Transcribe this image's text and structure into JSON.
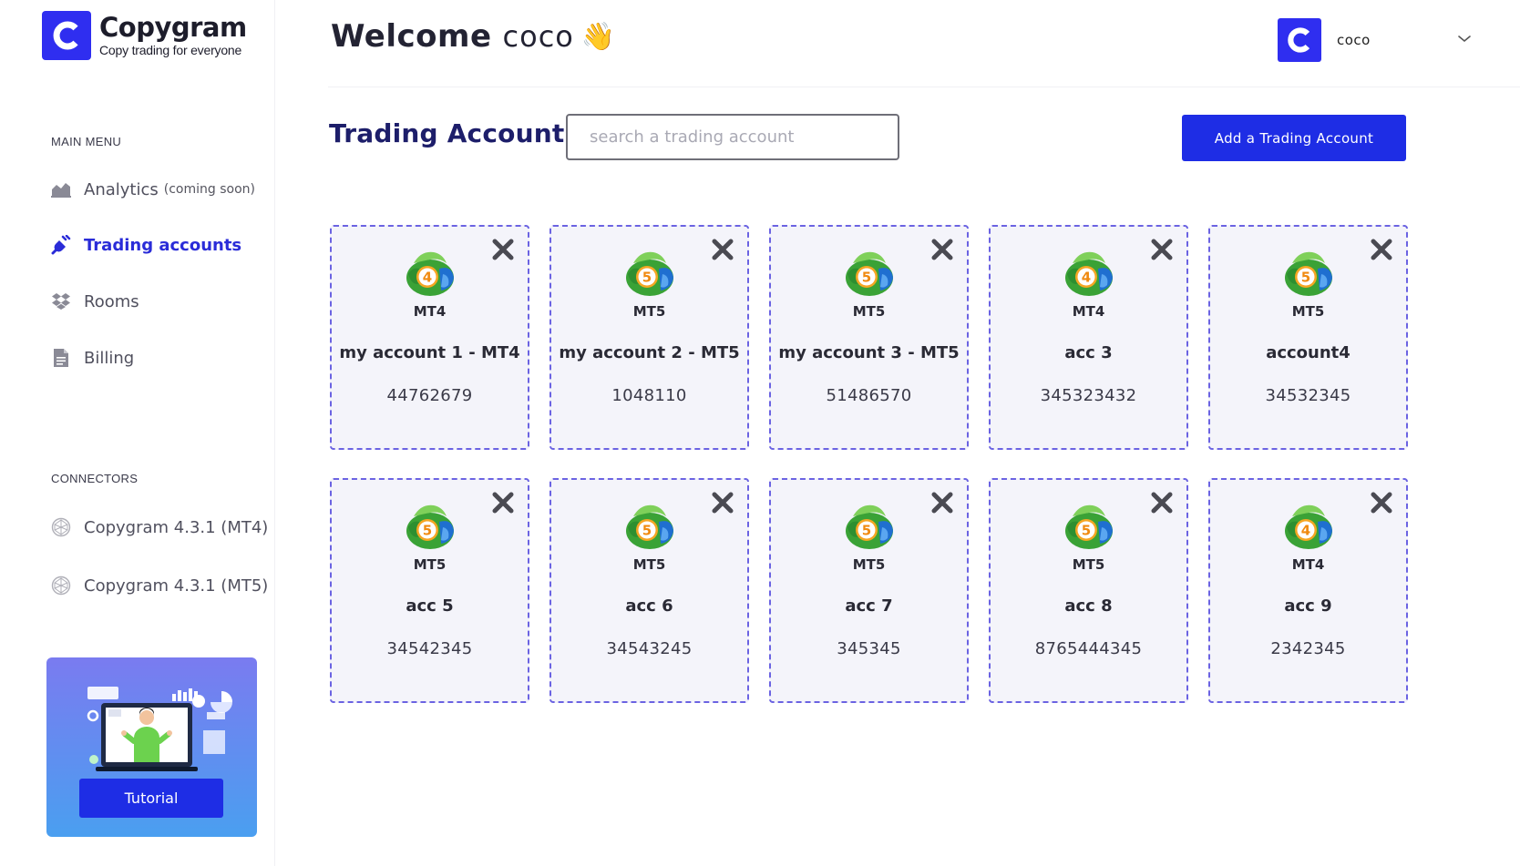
{
  "brand": {
    "name": "Copygram",
    "tagline": "Copy trading for everyone"
  },
  "header": {
    "welcome": "Welcome",
    "username": "coco",
    "wave_icon": "👋"
  },
  "user_menu": {
    "name": "coco"
  },
  "sidebar": {
    "main_menu_heading": "MAIN MENU",
    "items": [
      {
        "label": "Analytics",
        "note": "(coming soon)",
        "icon": "chart-icon"
      },
      {
        "label": "Trading accounts",
        "icon": "plug-icon",
        "active": true
      },
      {
        "label": "Rooms",
        "icon": "dropbox-icon"
      },
      {
        "label": "Billing",
        "icon": "document-icon"
      }
    ],
    "connectors_heading": "CONNECTORS",
    "connectors": [
      {
        "label": "Copygram 4.3.1 (MT4)"
      },
      {
        "label": "Copygram 4.3.1 (MT5)"
      }
    ],
    "tutorial_label": "Tutorial"
  },
  "main": {
    "title": "Trading Accounts",
    "search_placeholder": "search a trading account",
    "add_button": "Add a Trading Account",
    "accounts": [
      {
        "platform": "MT4",
        "version": "4",
        "name": "my account 1 - MT4",
        "number": "44762679"
      },
      {
        "platform": "MT5",
        "version": "5",
        "name": "my account 2 - MT5",
        "number": "1048110"
      },
      {
        "platform": "MT5",
        "version": "5",
        "name": "my account 3 - MT5",
        "number": "51486570"
      },
      {
        "platform": "MT4",
        "version": "4",
        "name": "acc 3",
        "number": "345323432"
      },
      {
        "platform": "MT5",
        "version": "5",
        "name": "account4",
        "number": "34532345"
      },
      {
        "platform": "MT5",
        "version": "5",
        "name": "acc 5",
        "number": "34542345"
      },
      {
        "platform": "MT5",
        "version": "5",
        "name": "acc 6",
        "number": "34543245"
      },
      {
        "platform": "MT5",
        "version": "5",
        "name": "acc 7",
        "number": "345345"
      },
      {
        "platform": "MT5",
        "version": "5",
        "name": "acc 8",
        "number": "8765444345"
      },
      {
        "platform": "MT4",
        "version": "4",
        "name": "acc 9",
        "number": "2342345"
      }
    ]
  },
  "colors": {
    "brand": "#2f2ef0",
    "accent_button": "#1e2de5",
    "active_nav": "#2a2cd8",
    "card_border": "#6b63e2",
    "title": "#1d1e6a"
  }
}
